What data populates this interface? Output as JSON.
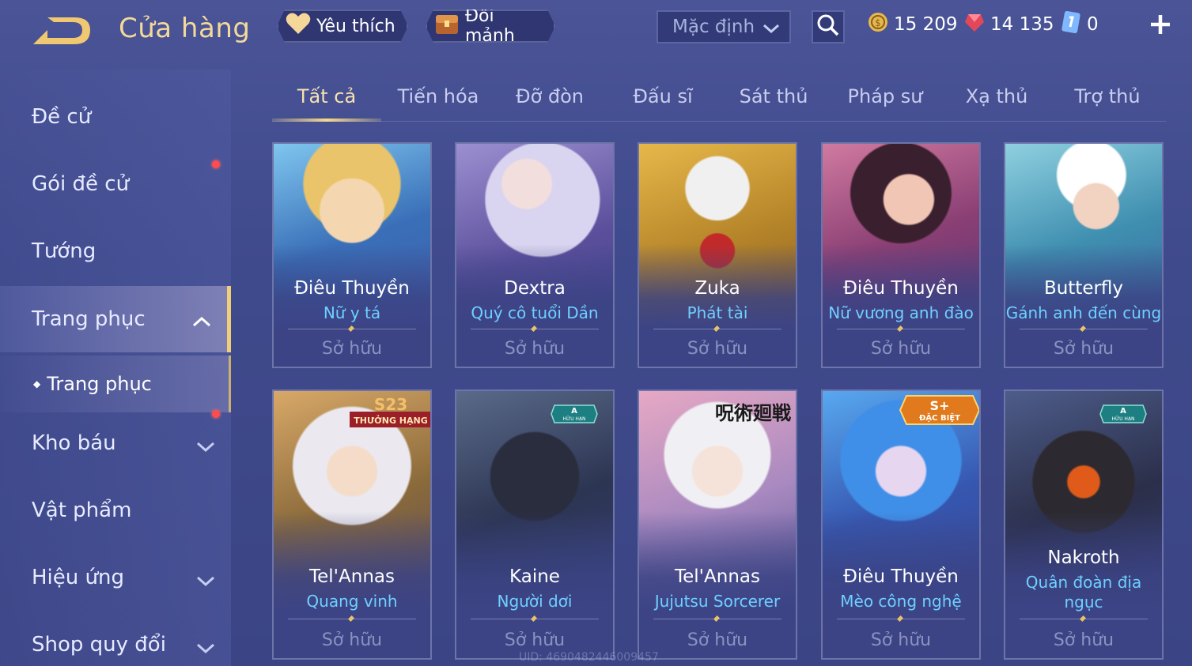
{
  "header": {
    "title": "Cửa hàng",
    "favorites_label": "Yêu thích",
    "shard_exchange_label": "Đổi mảnh",
    "sort_value": "Mặc định",
    "currencies": {
      "gold": "15 209",
      "ruby": "14 135",
      "voucher": "0"
    }
  },
  "sidebar": {
    "items": [
      {
        "label": "Đề cử"
      },
      {
        "label": "Gói đề cử"
      },
      {
        "label": "Tướng"
      },
      {
        "label": "Trang phục"
      },
      {
        "label": "Kho báu"
      },
      {
        "label": "Vật phẩm"
      },
      {
        "label": "Hiệu ứng"
      },
      {
        "label": "Shop quy đổi"
      }
    ],
    "sub_item": "Trang phục"
  },
  "tabs": [
    "Tất cả",
    "Tiến hóa",
    "Đỡ đòn",
    "Đấu sĩ",
    "Sát thủ",
    "Pháp sư",
    "Xạ thủ",
    "Trợ thủ"
  ],
  "cards": [
    {
      "hero": "Điêu Thuyền",
      "skin": "Nữ y tá",
      "status": "Sở hữu"
    },
    {
      "hero": "Dextra",
      "skin": "Quý cô tuổi Dần",
      "status": "Sở hữu"
    },
    {
      "hero": "Zuka",
      "skin": "Phát tài",
      "status": "Sở hữu"
    },
    {
      "hero": "Điêu Thuyền",
      "skin": "Nữ vương anh đào",
      "status": "Sở hữu"
    },
    {
      "hero": "Butterfly",
      "skin": "Gánh anh đến cùng",
      "status": "Sở hữu"
    },
    {
      "hero": "Tel'Annas",
      "skin": "Quang vinh",
      "status": "Sở hữu",
      "badge": "S23",
      "badge_sub": "THƯỞNG HẠNG"
    },
    {
      "hero": "Kaine",
      "skin": "Người dơi",
      "status": "Sở hữu",
      "badge": "A",
      "badge_sub": "HỮU HẠN"
    },
    {
      "hero": "Tel'Annas",
      "skin": "Jujutsu Sorcerer",
      "status": "Sở hữu",
      "badge": "呪術廻戦"
    },
    {
      "hero": "Điêu Thuyền",
      "skin": "Mèo công nghệ",
      "status": "Sở hữu",
      "badge": "S+",
      "badge_sub": "ĐẶC BIỆT"
    },
    {
      "hero": "Nakroth",
      "skin_line1": "Quân đoàn địa",
      "skin_line2": "ngục",
      "status": "Sở hữu",
      "badge": "A",
      "badge_sub": "HỮU HẠN"
    }
  ],
  "footer": {
    "uid": "UID: 4690482446009457"
  },
  "colors": {
    "background": "#414b8e",
    "title_gold": "#f3d99a",
    "skin_name": "#6fd0ff",
    "red_dot": "#ff4b4b"
  }
}
